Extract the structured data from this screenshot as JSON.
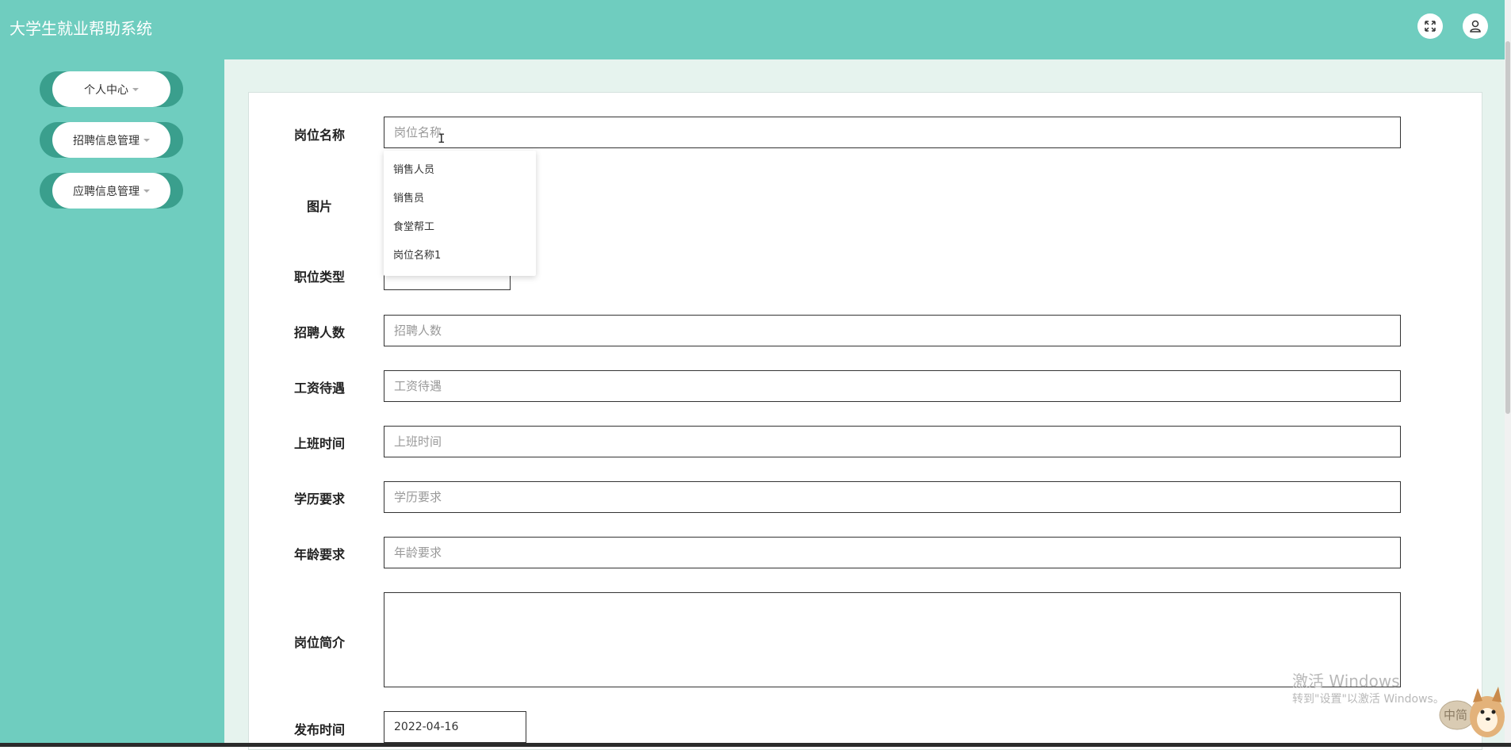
{
  "app": {
    "title": "大学生就业帮助系统"
  },
  "header": {
    "fullscreen_icon": "fullscreen-icon",
    "user_icon": "user-icon"
  },
  "sidebar": {
    "items": [
      {
        "label": "个人中心"
      },
      {
        "label": "招聘信息管理"
      },
      {
        "label": "应聘信息管理"
      }
    ]
  },
  "form": {
    "job_name": {
      "label": "岗位名称",
      "placeholder": "岗位名称"
    },
    "image": {
      "label": "图片"
    },
    "job_type": {
      "label": "职位类型"
    },
    "headcount": {
      "label": "招聘人数",
      "placeholder": "招聘人数"
    },
    "salary": {
      "label": "工资待遇",
      "placeholder": "工资待遇"
    },
    "work_time": {
      "label": "上班时间",
      "placeholder": "上班时间"
    },
    "education": {
      "label": "学历要求",
      "placeholder": "学历要求"
    },
    "age": {
      "label": "年龄要求",
      "placeholder": "年龄要求"
    },
    "intro": {
      "label": "岗位简介"
    },
    "publish_time": {
      "label": "发布时间",
      "value": "2022-04-16"
    }
  },
  "autocomplete": {
    "items": [
      "销售人员",
      "销售员",
      "食堂帮工",
      "岗位名称1"
    ]
  },
  "watermark": {
    "line1": "激活 Windows",
    "line2": "转到\"设置\"以激活 Windows。"
  },
  "ime": {
    "label": "中简"
  },
  "colors": {
    "primary": "#6fcdbf",
    "sidebar_dark": "#3a9f8d",
    "content_bg": "#e6f3ee"
  }
}
